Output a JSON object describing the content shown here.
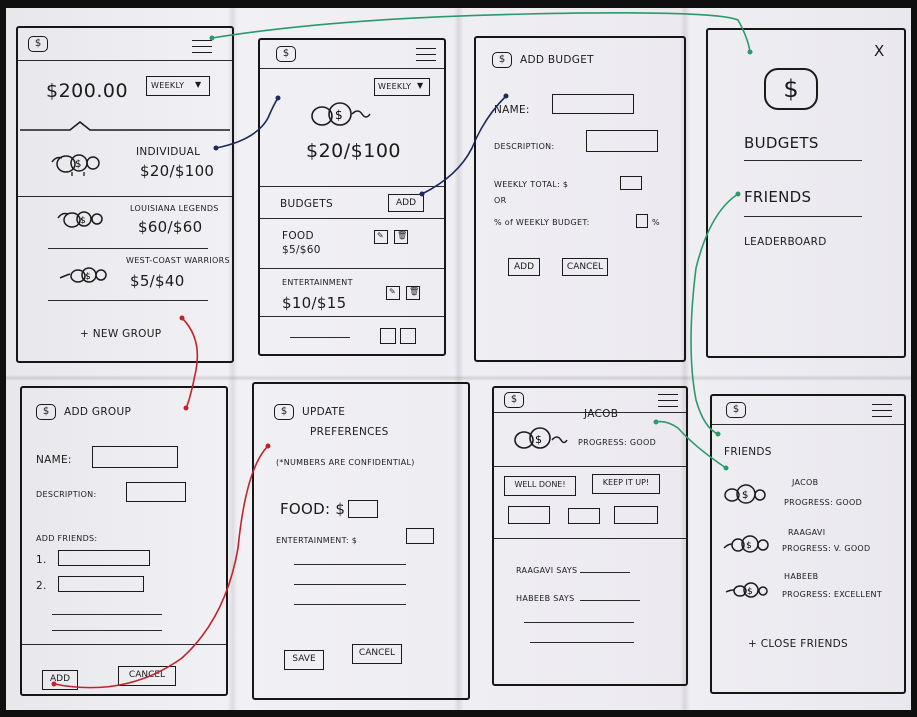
{
  "screens": {
    "home": {
      "balance": "$200.00",
      "period": "WEEKLY",
      "groups": [
        {
          "name": "INDIVIDUAL",
          "amount": "$20/$100"
        },
        {
          "name": "LOUISIANA LEGENDS",
          "amount": "$60/$60"
        },
        {
          "name": "WEST-COAST WARRIORS",
          "amount": "$5/$40"
        }
      ],
      "new_group": "+ NEW GROUP"
    },
    "group_detail": {
      "period": "WEEKLY",
      "amount": "$20/$100",
      "budgets_label": "BUDGETS",
      "add_label": "ADD",
      "budgets": [
        {
          "name": "FOOD",
          "amount": "$5/$60"
        },
        {
          "name": "ENTERTAINMENT",
          "amount": "$10/$15"
        }
      ]
    },
    "add_budget": {
      "title": "ADD BUDGET",
      "name_label": "NAME:",
      "description_label": "DESCRIPTION:",
      "weekly_total_label": "WEEKLY TOTAL: $",
      "or_label": "OR",
      "percent_label": "% of WEEKLY BUDGET:",
      "percent_suffix": "%",
      "add_label": "ADD",
      "cancel_label": "CANCEL"
    },
    "menu_drawer": {
      "close": "X",
      "items": [
        "BUDGETS",
        "FRIENDS",
        "LEADERBOARD"
      ]
    },
    "add_group": {
      "title": "ADD GROUP",
      "name_label": "NAME:",
      "description_label": "DESCRIPTION:",
      "add_friends_label": "ADD FRIENDS:",
      "friend_1": "1.",
      "friend_2": "2.",
      "add_label": "ADD",
      "cancel_label": "CANCEL"
    },
    "update_prefs": {
      "title_line1": "UPDATE",
      "title_line2": "PREFERENCES",
      "note": "(*NUMBERS ARE CONFIDENTIAL)",
      "food_label": "FOOD: $",
      "entertainment_label": "ENTERTAINMENT: $",
      "save_label": "SAVE",
      "cancel_label": "CANCEL"
    },
    "friend_profile": {
      "name": "JACOB",
      "progress": "PROGRESS: GOOD",
      "well_done": "WELL DONE!",
      "keep_it_up": "KEEP IT UP!",
      "comment_1": "RAAGAVI SAYS",
      "comment_2": "HABEEB SAYS"
    },
    "friends_list": {
      "title": "FRIENDS",
      "friends": [
        {
          "name": "JACOB",
          "progress": "PROGRESS: GOOD"
        },
        {
          "name": "RAAGAVI",
          "progress": "PROGRESS: V. GOOD"
        },
        {
          "name": "HABEEB",
          "progress": "PROGRESS: EXCELLENT"
        }
      ],
      "close_friends": "+ CLOSE FRIENDS"
    }
  },
  "icons": {
    "currency": "$",
    "dropdown": "dropdown-arrow-icon",
    "menu": "hamburger-menu-icon",
    "piggy": "piggy-bank-icon",
    "edit": "edit-pencil-icon",
    "delete": "trash-icon"
  },
  "colors": {
    "ink": "#1b1b1b",
    "link_green": "#2a9a6a",
    "link_red": "#c2232b",
    "link_navy": "#1d2a5c"
  }
}
